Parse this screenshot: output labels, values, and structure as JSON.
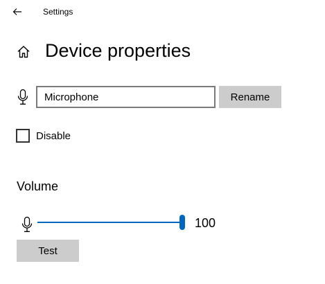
{
  "window": {
    "title": "Settings",
    "back_icon": "back-arrow-icon"
  },
  "header": {
    "home_icon": "home-icon",
    "title": "Device properties"
  },
  "rename": {
    "icon": "microphone-icon",
    "name_value": "Microphone",
    "button_label": "Rename"
  },
  "disable": {
    "label": "Disable",
    "checked": false
  },
  "volume": {
    "heading": "Volume",
    "icon": "microphone-icon",
    "value": 100,
    "value_label": "100",
    "min": 0,
    "max": 100,
    "test_label": "Test"
  },
  "colors": {
    "accent": "#0067c0",
    "button_bg": "#cccccc",
    "input_border": "#7a7a7a",
    "track": "#999999"
  }
}
